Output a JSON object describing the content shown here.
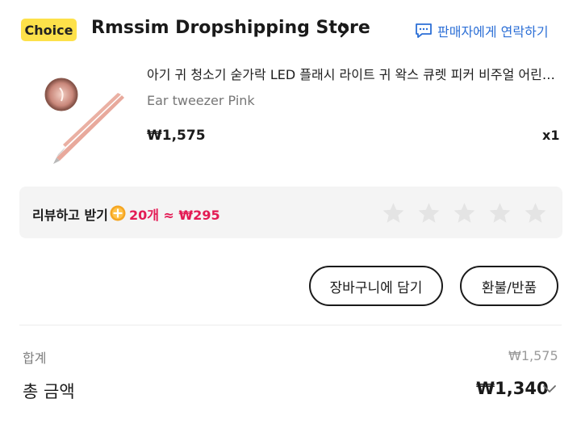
{
  "store": {
    "badge": "Choice",
    "name": "Rmssim Dropshipping Store",
    "contact_label": "판매자에게 연락하기"
  },
  "product": {
    "title": "아기 귀 청소기 숟가락 LED 플래시 라이트 귀 왁스 큐렛 피커 비주얼 어린이 귀 청소기",
    "variant": "Ear tweezer Pink",
    "price": "₩1,575",
    "quantity": "x1"
  },
  "review": {
    "label": "리뷰하고 받기",
    "reward": "20개 ≈ ₩295",
    "stars": 5,
    "coin_color": "#f5a623"
  },
  "actions": {
    "cart_label": "장바구니에 담기",
    "refund_label": "환불/반품"
  },
  "summary": {
    "subtotal_label": "합계",
    "subtotal_value": "₩1,575",
    "total_label": "총 금액",
    "total_value": "₩1,340"
  },
  "colors": {
    "badge": "#fde14a",
    "link": "#2c6fd6",
    "reward": "#e31b54",
    "star": "#e4e4e4"
  }
}
